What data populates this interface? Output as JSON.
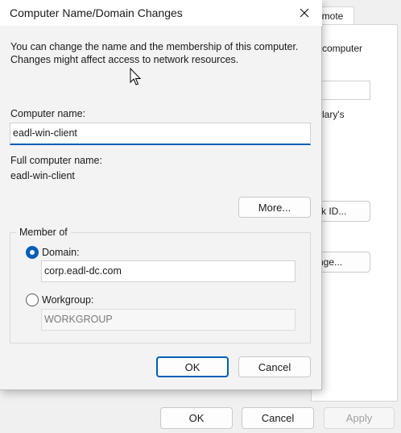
{
  "background_window": {
    "tab_label": "emote",
    "text_computer": "computer",
    "text_library": "lary's",
    "network_id_button": "rk ID...",
    "change_button": "nge...",
    "ok_label": "OK",
    "cancel_label": "Cancel",
    "apply_label": "Apply"
  },
  "dialog": {
    "title": "Computer Name/Domain Changes",
    "description": "You can change the name and the membership of this computer. Changes might affect access to network resources.",
    "computer_name_label": "Computer name:",
    "computer_name_value": "eadl-win-client",
    "full_name_label": "Full computer name:",
    "full_name_value": "eadl-win-client",
    "more_button": "More...",
    "member_of_label": "Member of",
    "domain_label": "Domain:",
    "domain_value": "corp.eadl-dc.com",
    "workgroup_label": "Workgroup:",
    "workgroup_value": "WORKGROUP",
    "ok_label": "OK",
    "cancel_label": "Cancel"
  },
  "colors": {
    "accent": "#005fb8"
  }
}
